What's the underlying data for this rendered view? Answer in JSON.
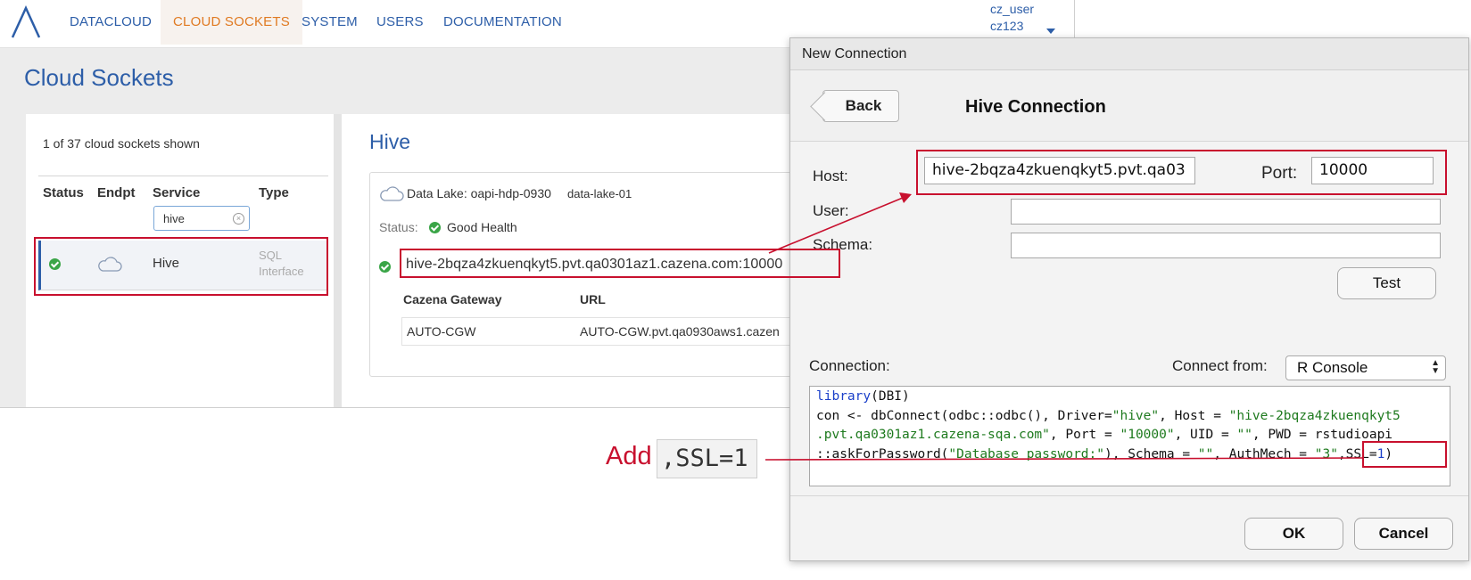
{
  "nav": {
    "items": [
      "DATACLOUD",
      "CLOUD SOCKETS",
      "SYSTEM",
      "USERS",
      "DOCUMENTATION"
    ],
    "active": "CLOUD SOCKETS",
    "user_name": "cz_user",
    "user_org": "cz123"
  },
  "page": {
    "title": "Cloud Sockets"
  },
  "sockets": {
    "count_text": "1 of 37 cloud sockets shown",
    "columns": [
      "Status",
      "Endpt",
      "Service",
      "Type"
    ],
    "filter_value": "hive",
    "rows": [
      {
        "service": "Hive",
        "type": "SQL Interface",
        "status": "ok",
        "endpoint_icon": "cloud-icon"
      }
    ]
  },
  "detail": {
    "title": "Hive",
    "data_lake_label": "Data Lake: oapi-hdp-0930",
    "data_lake_id": "data-lake-01",
    "status_label": "Status:",
    "status_value": "Good Health",
    "endpoint": "hive-2bqza4zkuenqkyt5.pvt.qa0301az1.cazena.com:10000",
    "gateway_columns": [
      "Cazena Gateway",
      "URL"
    ],
    "gateway_rows": [
      {
        "name": "AUTO-CGW",
        "url": "AUTO-CGW.pvt.qa0930aws1.cazen"
      }
    ]
  },
  "dialog": {
    "window_title": "New Connection",
    "back_label": "Back",
    "heading": "Hive Connection",
    "host_label": "Host:",
    "host_value": "hive-2bqza4zkuenqkyt5.pvt.qa03",
    "port_label": "Port:",
    "port_value": "10000",
    "user_label": "User:",
    "user_value": "",
    "schema_label": "Schema:",
    "schema_value": "",
    "test_label": "Test",
    "connection_label": "Connection:",
    "connect_from_label": "Connect from:",
    "connect_from_value": "R Console",
    "code_lines": [
      "library(DBI)",
      "con <- dbConnect(odbc::odbc(), Driver=\"hive\", Host = \"hive-2bqza4zkuenqkyt5",
      ".pvt.qa0301az1.cazena-sqa.com\", Port = \"10000\", UID = \"\", PWD = rstudioapi",
      "::askForPassword(\"Database password:\"), Schema = \"\", AuthMech = \"3\",SSL=1)"
    ],
    "ok_label": "OK",
    "cancel_label": "Cancel"
  },
  "annotation": {
    "add_label": "Add",
    "code_chip": ",SSL=1",
    "color": "#c8102e"
  },
  "colors": {
    "brand_blue": "#2d5ea8",
    "active_orange": "#e07a22",
    "status_green": "#3aa547"
  }
}
